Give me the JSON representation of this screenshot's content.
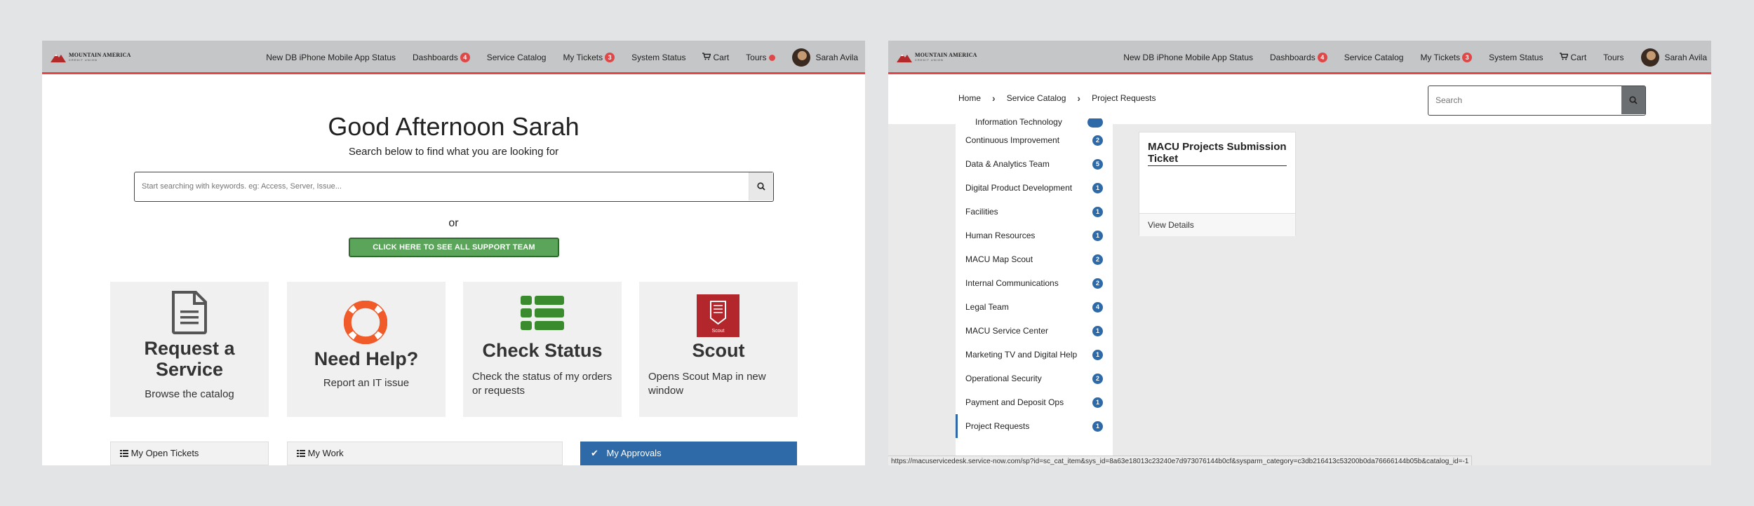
{
  "nav": {
    "logo_main": "MOUNTAIN AMERICA",
    "logo_sub": "CREDIT UNION",
    "items": [
      {
        "label": "New DB iPhone Mobile App Status"
      },
      {
        "label": "Dashboards",
        "badge": "4"
      },
      {
        "label": "Service Catalog"
      },
      {
        "label": "My Tickets",
        "badge": "3"
      },
      {
        "label": "System Status"
      },
      {
        "label": "Cart"
      },
      {
        "label": "Tours"
      }
    ],
    "user_name": "Sarah Avila"
  },
  "home": {
    "greeting": "Good Afternoon Sarah",
    "subtitle": "Search below to find what you are looking for",
    "search_placeholder": "Start searching with keywords. eg: Access, Server, Issue...",
    "or_text": "or",
    "cta_label": "CLICK HERE TO SEE ALL SUPPORT TEAM CATEGORIES",
    "cards": [
      {
        "title_line1": "Request a",
        "title_line2": "Service",
        "desc": "Browse the catalog",
        "icon": "document-icon"
      },
      {
        "title": "Need Help?",
        "desc": "Report an IT issue",
        "icon": "lifebuoy-icon"
      },
      {
        "title": "Check Status",
        "desc": "Check the status of my orders or requests",
        "icon": "list-icon"
      },
      {
        "title": "Scout",
        "desc": "Opens Scout Map in new window",
        "icon": "scout-logo",
        "icon_label": "Scout"
      }
    ],
    "bottom_tabs": [
      "My Open Tickets",
      "My Work",
      "My Approvals"
    ]
  },
  "catalog": {
    "breadcrumb": [
      "Home",
      "Service Catalog",
      "Project Requests"
    ],
    "search_placeholder": "Search",
    "partial_top_category": "Information Technology",
    "categories": [
      {
        "label": "Continuous Improvement",
        "count": "2"
      },
      {
        "label": "Data & Analytics Team",
        "count": "5"
      },
      {
        "label": "Digital Product Development",
        "count": "1"
      },
      {
        "label": "Facilities",
        "count": "1"
      },
      {
        "label": "Human Resources",
        "count": "1"
      },
      {
        "label": "MACU Map Scout",
        "count": "2"
      },
      {
        "label": "Internal Communications",
        "count": "2"
      },
      {
        "label": "Legal Team",
        "count": "4"
      },
      {
        "label": "MACU Service Center",
        "count": "1"
      },
      {
        "label": "Marketing TV and Digital Help",
        "count": "1"
      },
      {
        "label": "Operational Security",
        "count": "2"
      },
      {
        "label": "Payment and Deposit Ops",
        "count": "1"
      },
      {
        "label": "Project Requests",
        "count": "1"
      }
    ],
    "item": {
      "title": "MACU Projects Submission Ticket",
      "view_details": "View Details"
    },
    "status_url": "https://macuservicedesk.service-now.com/sp?id=sc_cat_item&sys_id=8a63e18013c23240e7d973076144b0cf&sysparm_category=c3db216413c53200b0da76666144b05b&catalog_id=-1"
  },
  "colors": {
    "accent_red": "#e04848",
    "brand_blue": "#2e69a8",
    "cta_green": "#5aa55a",
    "header_gray": "#c5c6c8"
  }
}
